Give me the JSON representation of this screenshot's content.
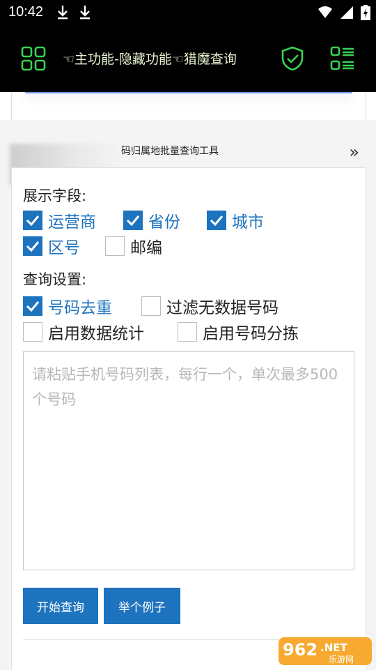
{
  "status_bar": {
    "time": "10:42",
    "icons": [
      "download-icon",
      "download-icon",
      "wifi-icon",
      "signal-icon",
      "battery-charging-icon"
    ]
  },
  "app_bar": {
    "title": "☜主功能-隐藏功能☜猎魔查询",
    "accent_color": "#39d353",
    "icons": [
      "grid-menu-icon",
      "shield-check-icon",
      "list-menu-icon"
    ]
  },
  "breadcrumb": {
    "text": "码归属地批量查询工具",
    "more_icon": "double-chevron-right-icon"
  },
  "display_fields": {
    "label": "展示字段:",
    "options": [
      {
        "label": "运营商",
        "checked": true
      },
      {
        "label": "省份",
        "checked": true
      },
      {
        "label": "城市",
        "checked": true
      },
      {
        "label": "区号",
        "checked": true
      },
      {
        "label": "邮编",
        "checked": false
      }
    ]
  },
  "query_settings": {
    "label": "查询设置:",
    "options": [
      {
        "label": "号码去重",
        "checked": true
      },
      {
        "label": "过滤无数据号码",
        "checked": false
      },
      {
        "label": "启用数据统计",
        "checked": false
      },
      {
        "label": "启用号码分拣",
        "checked": false
      }
    ]
  },
  "input": {
    "value": "",
    "placeholder": "请粘贴手机号码列表，每行一个，单次最多500个号码"
  },
  "buttons": {
    "start": "开始查询",
    "example": "举个例子"
  },
  "colors": {
    "primary": "#1e73be",
    "appbar_bg": "#000000"
  },
  "watermark": {
    "number": "962",
    "suffix": ".NET",
    "site": "乐游网"
  }
}
